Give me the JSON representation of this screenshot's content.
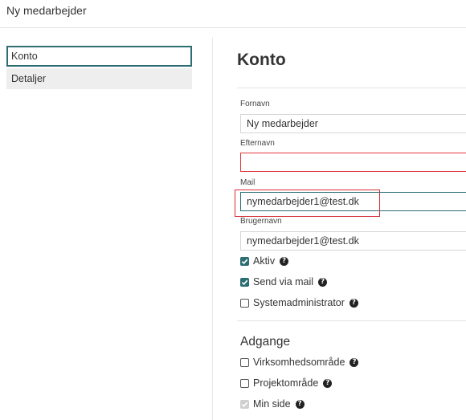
{
  "header": {
    "title": "Ny medarbejder"
  },
  "sidebar": {
    "items": [
      {
        "label": "Konto",
        "active": true
      },
      {
        "label": "Detaljer",
        "active": false
      }
    ]
  },
  "main": {
    "heading": "Konto",
    "fields": {
      "fornavn": {
        "label": "Fornavn",
        "value": "Ny medarbejder"
      },
      "efternavn": {
        "label": "Efternavn",
        "value": ""
      },
      "mail": {
        "label": "Mail",
        "value": "nymedarbejder1@test.dk"
      },
      "brugernavn": {
        "label": "Brugernavn",
        "value": "nymedarbejder1@test.dk"
      }
    },
    "checks": {
      "aktiv": {
        "label": "Aktiv",
        "checked": true
      },
      "send_via_mail": {
        "label": "Send via mail",
        "checked": true
      },
      "systemadministrator": {
        "label": "Systemadministrator",
        "checked": false
      }
    },
    "adgange": {
      "heading": "Adgange",
      "virksomhedsomraade": {
        "label": "Virksomhedsområde",
        "checked": false
      },
      "projektomraade": {
        "label": "Projektområde",
        "checked": false
      },
      "min_side": {
        "label": "Min side",
        "checked": true,
        "disabled": true
      }
    }
  },
  "icons": {
    "help": "question-circle-icon",
    "check": "checkmark-icon"
  },
  "colors": {
    "accent": "#2d6e73",
    "error": "#e0353d",
    "annotation": "#d42f37"
  }
}
